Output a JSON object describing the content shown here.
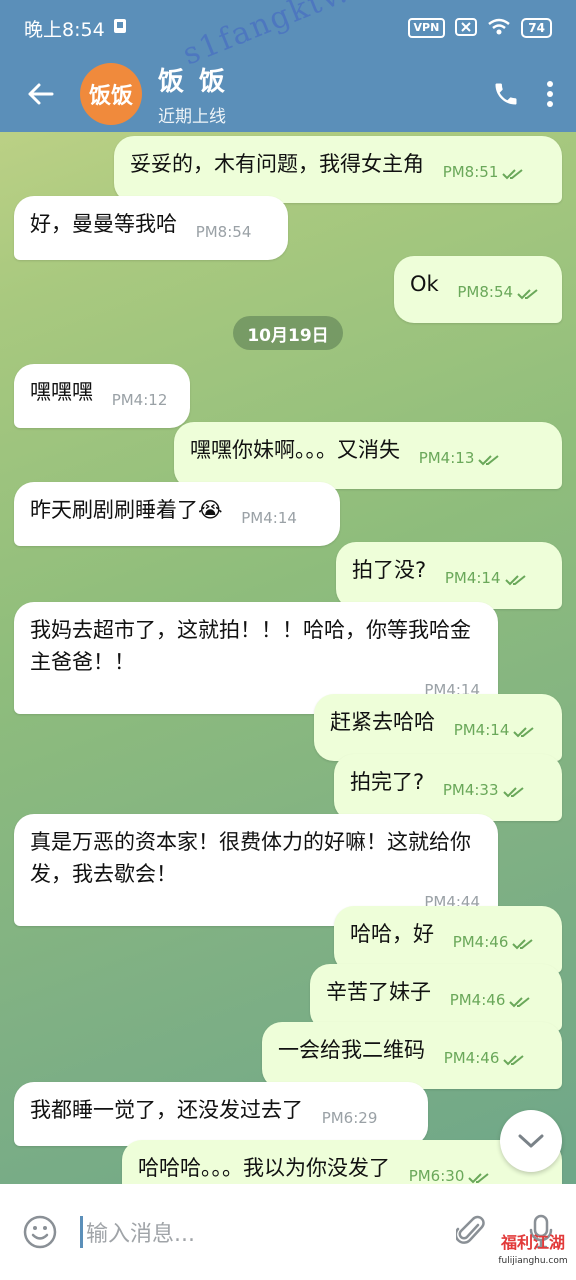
{
  "status_bar": {
    "time": "晚上8:54",
    "vpn": "VPN",
    "battery": "74"
  },
  "header": {
    "avatar_text": "饭饭",
    "name": "饭 饭",
    "status": "近期上线"
  },
  "watermark": "s1fangktv.com",
  "date_divider": "10月19日",
  "messages": [
    {
      "dir": "out",
      "text": "妥妥的，木有问题，我得女主角",
      "time": "PM8:51"
    },
    {
      "dir": "in",
      "text": "好，曼曼等我哈",
      "time": "PM8:54"
    },
    {
      "dir": "out",
      "text": "Ok",
      "time": "PM8:54"
    },
    {
      "dir": "in",
      "text": "嘿嘿嘿",
      "time": "PM4:12"
    },
    {
      "dir": "out",
      "text": "嘿嘿你妹啊。。。又消失",
      "time": "PM4:13"
    },
    {
      "dir": "in",
      "text": "昨天刷剧刷睡着了😭",
      "time": "PM4:14"
    },
    {
      "dir": "out",
      "text": "拍了没?",
      "time": "PM4:14"
    },
    {
      "dir": "in",
      "text": "我妈去超市了，这就拍！！！哈哈，你等我哈金主爸爸！！",
      "time": "PM4:14"
    },
    {
      "dir": "out",
      "text": "赶紧去哈哈",
      "time": "PM4:14"
    },
    {
      "dir": "out",
      "text": "拍完了?",
      "time": "PM4:33"
    },
    {
      "dir": "in",
      "text": "真是万恶的资本家！很费体力的好嘛！这就给你发，我去歇会！",
      "time": "PM4:44"
    },
    {
      "dir": "out",
      "text": "哈哈，好",
      "time": "PM4:46"
    },
    {
      "dir": "out",
      "text": "辛苦了妹子",
      "time": "PM4:46"
    },
    {
      "dir": "out",
      "text": "一会给我二维码",
      "time": "PM4:46"
    },
    {
      "dir": "in",
      "text": "我都睡一觉了，还没发过去了",
      "time": "PM6:29"
    },
    {
      "dir": "out",
      "text": "哈哈哈。。。我以为你没发了",
      "time": "PM6:30"
    }
  ],
  "input": {
    "placeholder": "输入消息..."
  },
  "brand_watermark": {
    "name": "福利江湖",
    "url": "fulijianghu.com"
  },
  "colors": {
    "header": "#5b8fb9",
    "outgoing_bubble": "#eefed9",
    "incoming_bubble": "#ffffff",
    "avatar": "#f08a3c",
    "tick": "#6aa85a"
  }
}
